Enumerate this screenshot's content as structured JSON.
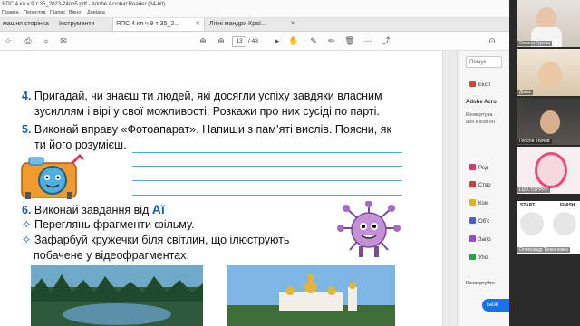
{
  "window": {
    "title": "ЯПС 4 кл ч 9 т 35_2023-24np5.pdf - Adobe Acrobat Reader (64-bit)"
  },
  "menu": [
    "Правка",
    "Перегляд",
    "Підпис",
    "Вікно",
    "Довідка"
  ],
  "tabs": [
    {
      "label": "машня сторінка"
    },
    {
      "label": "Інструменти"
    },
    {
      "label": "ЯПС 4 кл ч 9 т 35_2..."
    },
    {
      "label": "Літні мандри Краї..."
    }
  ],
  "toolbar": {
    "page_current": "13",
    "page_total": "/ 48"
  },
  "document": {
    "ex4": {
      "num": "4.",
      "line1": "Пригадай, чи знаєш ти людей, які досягли успіху завдяки власним",
      "line2": "зусиллям і вірі у свої можливості. Розкажи про них сусіді по парті."
    },
    "ex5": {
      "num": "5.",
      "line1": "Виконай вправу «Фотоапарат». Напиши з пам’яті вислів. Поясни, як",
      "line2": "ти його розумієш."
    },
    "ex6": {
      "num": "6.",
      "text": "Виконай завдання від",
      "ai": "Aї"
    },
    "bullet1": "Переглянь фрагменти фільму.",
    "bullet2a": "Зафарбуй кружечки біля світлин, що ілюструють",
    "bullet2b": "побачене у відеофрагментах."
  },
  "right_panel": {
    "search_placeholder": "Пошук",
    "export_label": "Експ",
    "adobe_title": "Adobe Acro",
    "adobe_desc1": "Конвертува",
    "adobe_desc2": "або Excel он",
    "items": [
      "Ред",
      "Ство",
      "Ком",
      "Об'є",
      "Запо",
      "Упо"
    ],
    "convert_label": "Конвертуйте",
    "button_label": "Безк"
  },
  "video": {
    "participants": [
      {
        "name": "Оксана Гурова"
      },
      {
        "name": "Діана"
      },
      {
        "name": "Георгій Ткачов"
      },
      {
        "name": "LIZA TOPPPP"
      },
      {
        "name": "Олександр Тонконожко"
      }
    ],
    "slide_start": "START",
    "slide_finish": "FINISH"
  },
  "colors": {
    "accent_blue": "#1a8fd8",
    "number_blue": "#1c5aa8",
    "writing_line": "#4fa8d8"
  }
}
